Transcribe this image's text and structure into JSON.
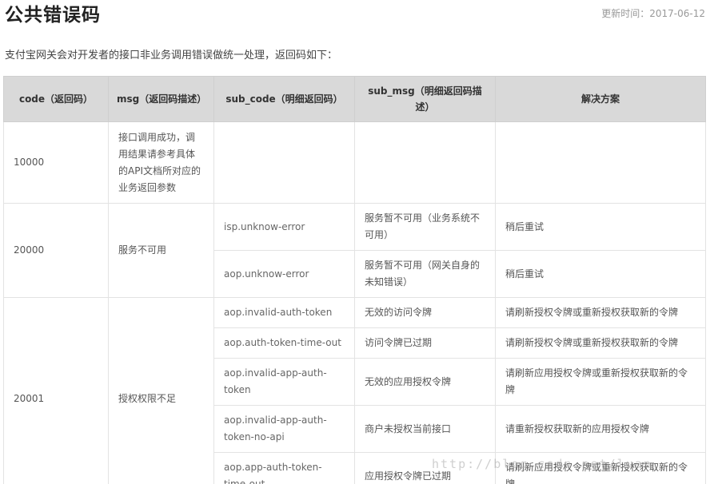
{
  "header": {
    "title": "公共错误码",
    "updated": "更新时间：2017-06-12"
  },
  "intro": "支付宝网关会对开发者的接口非业务调用错误做统一处理，返回码如下：",
  "table": {
    "headers": [
      "code（返回码）",
      "msg（返回码描述）",
      "sub_code（明细返回码）",
      "sub_msg（明细返回码描述）",
      "解决方案"
    ],
    "groups": [
      {
        "code": "10000",
        "msg": "接口调用成功，调用结果请参考具体的API文档所对应的业务返回参数",
        "rows": [
          {
            "sub_code": "",
            "sub_msg": "",
            "solution": ""
          }
        ]
      },
      {
        "code": "20000",
        "msg": "服务不可用",
        "rows": [
          {
            "sub_code": "isp.unknow-error",
            "sub_msg": "服务暂不可用（业务系统不可用）",
            "solution": "稍后重试"
          },
          {
            "sub_code": "aop.unknow-error",
            "sub_msg": "服务暂不可用（网关自身的未知错误）",
            "solution": "稍后重试"
          }
        ]
      },
      {
        "code": "20001",
        "msg": "授权权限不足",
        "rows": [
          {
            "sub_code": "aop.invalid-auth-token",
            "sub_msg": "无效的访问令牌",
            "solution": "请刷新授权令牌或重新授权获取新的令牌"
          },
          {
            "sub_code": "aop.auth-token-time-out",
            "sub_msg": "访问令牌已过期",
            "solution": "请刷新授权令牌或重新授权获取新的令牌"
          },
          {
            "sub_code": "aop.invalid-app-auth-token",
            "sub_msg": "无效的应用授权令牌",
            "solution": "请刷新应用授权令牌或重新授权获取新的令牌"
          },
          {
            "sub_code": "aop.invalid-app-auth-token-no-api",
            "sub_msg": "商户未授权当前接口",
            "solution": "请重新授权获取新的应用授权令牌"
          },
          {
            "sub_code": "aop.app-auth-token-time-out",
            "sub_msg": "应用授权令牌已过期",
            "solution": "请刷新应用授权令牌或重新授权获取新的令牌"
          }
        ]
      }
    ]
  },
  "watermark": "http://blog.csdn.net/luan"
}
